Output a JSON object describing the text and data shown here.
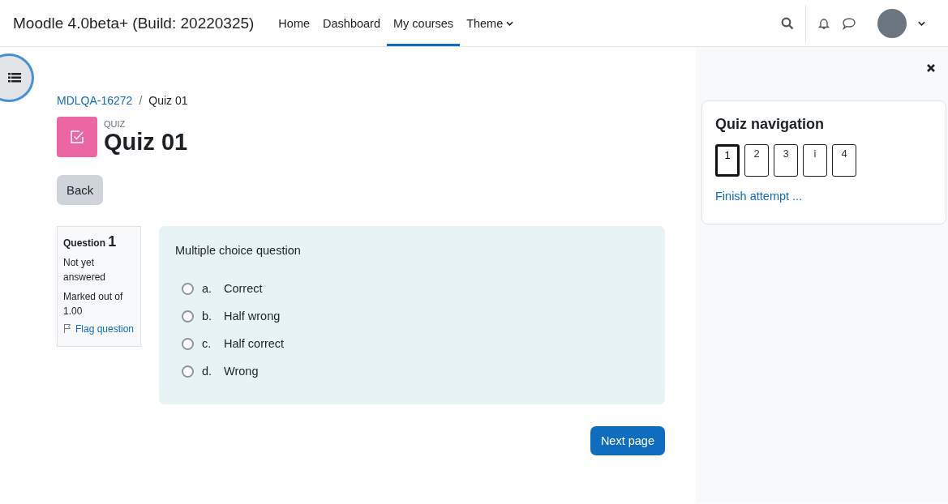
{
  "site_title": "Moodle 4.0beta+ (Build: 20220325)",
  "nav": [
    {
      "label": "Home",
      "selected": false,
      "dropdown": false
    },
    {
      "label": "Dashboard",
      "selected": false,
      "dropdown": false
    },
    {
      "label": "My courses",
      "selected": true,
      "dropdown": false
    },
    {
      "label": "Theme",
      "selected": false,
      "dropdown": true
    }
  ],
  "breadcrumb": [
    "MDLQA-16272",
    "Quiz 01"
  ],
  "breadcrumb_separator": "/",
  "activity": {
    "type_label": "QUIZ",
    "title": "Quiz 01"
  },
  "back_button": "Back",
  "question_info": {
    "label": "Question",
    "number": "1",
    "state": "Not yet answered",
    "mark": "Marked out of 1.00",
    "flag": "Flag question"
  },
  "question": {
    "prompt": "Multiple choice question",
    "options": [
      {
        "letter": "a.",
        "text": "Correct",
        "selected": false
      },
      {
        "letter": "b.",
        "text": "Half wrong",
        "selected": false
      },
      {
        "letter": "c.",
        "text": "Half correct",
        "selected": false
      },
      {
        "letter": "d.",
        "text": "Wrong",
        "selected": false
      }
    ]
  },
  "next_button": "Next page",
  "quiz_navigation": {
    "title": "Quiz navigation",
    "buttons": [
      {
        "label": "1",
        "selected": true
      },
      {
        "label": "2",
        "selected": false
      },
      {
        "label": "3",
        "selected": false
      },
      {
        "label": "i",
        "selected": false
      },
      {
        "label": "4",
        "selected": false
      }
    ],
    "finish": "Finish attempt ..."
  }
}
